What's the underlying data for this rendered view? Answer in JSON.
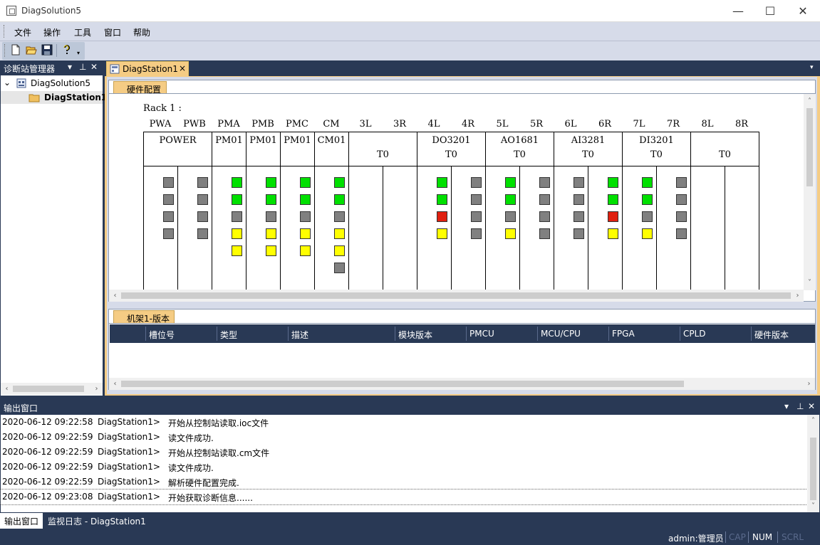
{
  "window": {
    "title": "DiagSolution5",
    "minimize": "—",
    "maximize": "☐",
    "close": "✕"
  },
  "menu": [
    "文件",
    "操作",
    "工具",
    "窗口",
    "帮助"
  ],
  "left_panel": {
    "title": "诊断站管理器",
    "tree": [
      {
        "label": "DiagSolution5"
      },
      {
        "label": "DiagStation1"
      }
    ]
  },
  "doc_tab": {
    "label": "DiagStation1",
    "close": "×"
  },
  "hardware": {
    "section_label": "硬件配置",
    "rack_label": "Rack 1 :",
    "slots": [
      "PWA",
      "PWB",
      "PMA",
      "PMB",
      "PMC",
      "CM",
      "3L",
      "3R",
      "4L",
      "4R",
      "5L",
      "5R",
      "6L",
      "6R",
      "7L",
      "7R",
      "8L",
      "8R"
    ],
    "modules": [
      {
        "name": "POWER",
        "sub": ""
      },
      {
        "name": "PM01",
        "sub": ""
      },
      {
        "name": "PM01",
        "sub": ""
      },
      {
        "name": "PM01",
        "sub": ""
      },
      {
        "name": "CM01",
        "sub": ""
      },
      {
        "name": "",
        "sub": "T0"
      },
      {
        "name": "DO3201",
        "sub": "T0"
      },
      {
        "name": "AO1681",
        "sub": "T0"
      },
      {
        "name": "AI3281",
        "sub": "T0"
      },
      {
        "name": "DI3201",
        "sub": "T0"
      },
      {
        "name": "",
        "sub": "T0"
      }
    ],
    "led_columns": [
      [
        "gray",
        "gray",
        "gray",
        "gray"
      ],
      [
        "gray",
        "gray",
        "gray",
        "gray"
      ],
      [
        "green",
        "green",
        "gray",
        "yellow",
        "yellow"
      ],
      [
        "green",
        "green",
        "gray",
        "yellow",
        "yellow"
      ],
      [
        "green",
        "green",
        "gray",
        "yellow",
        "yellow"
      ],
      [
        "green",
        "green",
        "gray",
        "yellow",
        "yellow",
        "gray"
      ],
      [],
      [],
      [
        "green",
        "green",
        "red",
        "yellow"
      ],
      [
        "gray",
        "gray",
        "gray",
        "gray"
      ],
      [
        "green",
        "green",
        "gray",
        "yellow"
      ],
      [
        "gray",
        "gray",
        "gray",
        "gray"
      ],
      [
        "gray",
        "gray",
        "gray",
        "gray"
      ],
      [
        "green",
        "green",
        "red",
        "yellow"
      ],
      [
        "green",
        "green",
        "gray",
        "yellow"
      ],
      [
        "gray",
        "gray",
        "gray",
        "gray"
      ],
      [],
      []
    ],
    "colors": {
      "green": "#00e000",
      "gray": "#808080",
      "red": "#e02010",
      "yellow": "#ffff00"
    }
  },
  "version": {
    "section_label": "机架1-版本",
    "columns": [
      "槽位号",
      "类型",
      "描述",
      "模块版本",
      "PMCU",
      "MCU/CPU",
      "FPGA",
      "CPLD",
      "硬件版本"
    ]
  },
  "output": {
    "title": "输出窗口",
    "rows": [
      {
        "time": "2020-06-12 09:22:58",
        "source": "DiagStation1>",
        "message": "开始从控制站读取.ioc文件"
      },
      {
        "time": "2020-06-12 09:22:59",
        "source": "DiagStation1>",
        "message": "读文件成功."
      },
      {
        "time": "2020-06-12 09:22:59",
        "source": "DiagStation1>",
        "message": "开始从控制站读取.cm文件"
      },
      {
        "time": "2020-06-12 09:22:59",
        "source": "DiagStation1>",
        "message": "读文件成功."
      },
      {
        "time": "2020-06-12 09:22:59",
        "source": "DiagStation1>",
        "message": "解析硬件配置完成."
      },
      {
        "time": "2020-06-12 09:23:08",
        "source": "DiagStation1>",
        "message": "开始获取诊断信息......"
      }
    ],
    "tabs": [
      "输出窗口",
      "监视日志 - DiagStation1"
    ]
  },
  "status": {
    "user": "admin:管理员",
    "cap": "CAP",
    "num": "NUM",
    "scrl": "SCRL"
  }
}
